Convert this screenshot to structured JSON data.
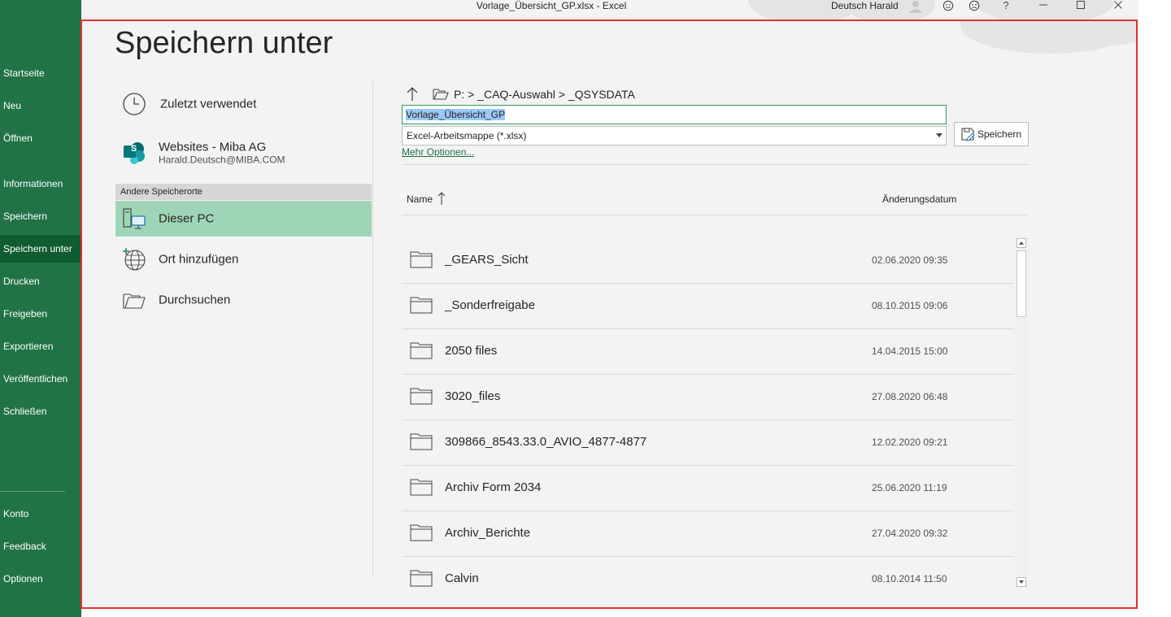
{
  "window": {
    "title": "Vorlage_Übersicht_GP.xlsx  -  Excel",
    "user_name": "Deutsch Harald",
    "controls": [
      "avatar-icon",
      "smile-icon",
      "frown-icon",
      "help-icon",
      "minimize-icon",
      "maximize-icon",
      "close-icon"
    ],
    "help_label": "?"
  },
  "sidebar": {
    "items": [
      {
        "label": "Startseite"
      },
      {
        "label": "Neu"
      },
      {
        "label": "Öffnen"
      },
      {
        "label": "Informationen"
      },
      {
        "label": "Speichern"
      },
      {
        "label": "Speichern unter",
        "active": true
      },
      {
        "label": "Drucken"
      },
      {
        "label": "Freigeben"
      },
      {
        "label": "Exportieren"
      },
      {
        "label": "Veröffentlichen"
      },
      {
        "label": "Schließen"
      }
    ],
    "footer": [
      {
        "label": "Konto"
      },
      {
        "label": "Feedback"
      },
      {
        "label": "Optionen"
      }
    ]
  },
  "page": {
    "title": "Speichern unter"
  },
  "locations": {
    "recent": "Zuletzt verwendet",
    "sharepoint": {
      "title": "Websites - Miba AG",
      "subtitle": "Harald.Deutsch@MIBA.COM",
      "badge": "S"
    },
    "group_header": "Andere Speicherorte",
    "this_pc": "Dieser PC",
    "add_place": "Ort hinzufügen",
    "browse": "Durchsuchen"
  },
  "save_panel": {
    "breadcrumb": "P: > _CAQ-Auswahl > _QSYSDATA",
    "filename": "Vorlage_Übersicht_GP",
    "filetype": "Excel-Arbeitsmappe (*.xlsx)",
    "save_label": "Speichern",
    "more_options": "Mehr Optionen...",
    "col_name": "Name",
    "col_date": "Änderungsdatum"
  },
  "files": [
    {
      "name": "_GEARS_Sicht",
      "date": "02.06.2020 09:35"
    },
    {
      "name": "_Sonderfreigabe",
      "date": "08.10.2015 09:06"
    },
    {
      "name": "2050 files",
      "date": "14.04.2015 15:00"
    },
    {
      "name": "3020_files",
      "date": "27.08.2020 06:48"
    },
    {
      "name": "309866_8543.33.0_AVIO_4877-4877",
      "date": "12.02.2020 09:21"
    },
    {
      "name": "Archiv Form 2034",
      "date": "25.06.2020 11:19"
    },
    {
      "name": "Archiv_Berichte",
      "date": "27.04.2020 09:32"
    },
    {
      "name": "Calvin",
      "date": "08.10.2014 11:50"
    }
  ],
  "colors": {
    "brand": "#217346",
    "sidebar_active": "#0e5c2f",
    "selected_location": "#9fd5b7",
    "highlight": "#e03030"
  }
}
